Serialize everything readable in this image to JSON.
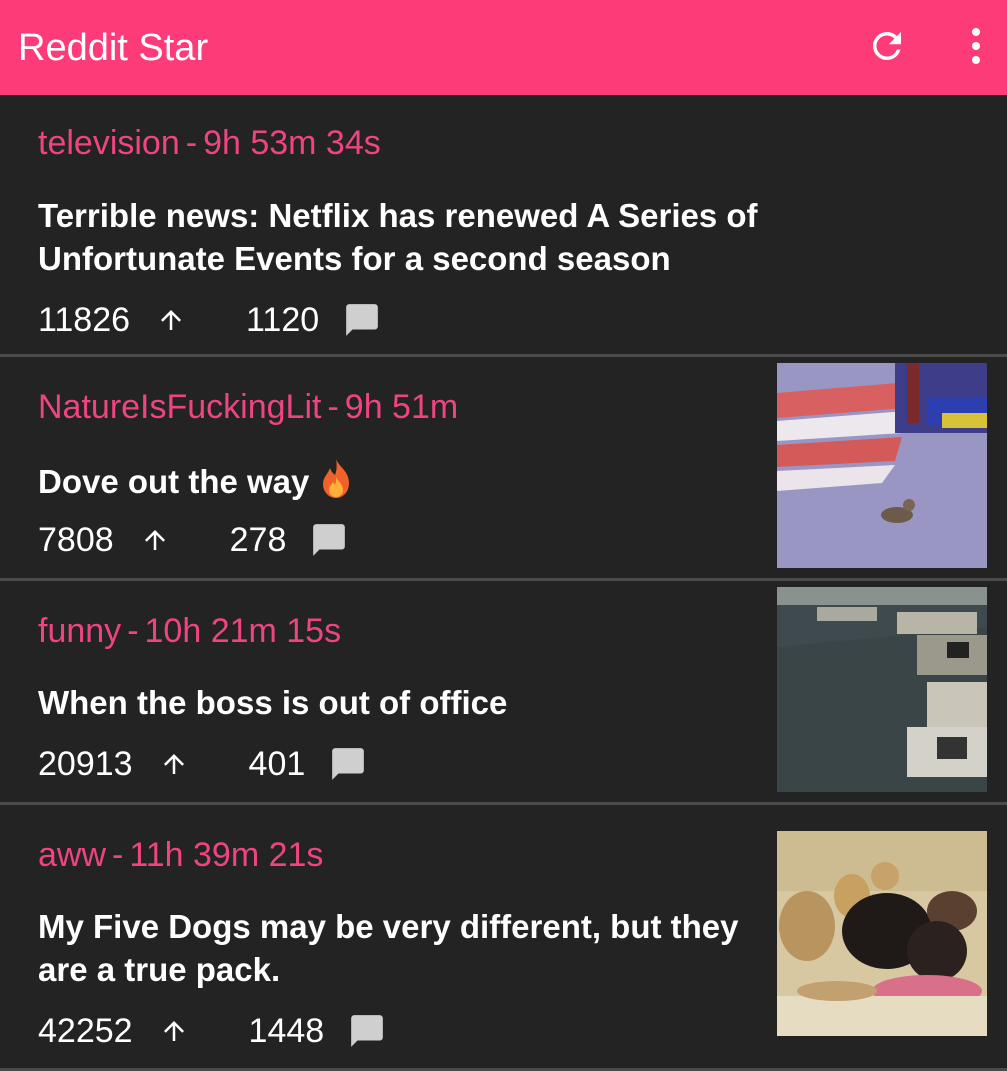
{
  "app": {
    "title": "Reddit Star",
    "bar_color": "#fd3b78",
    "actions": [
      {
        "name": "refresh-icon"
      },
      {
        "name": "more-vert-icon"
      }
    ]
  },
  "posts": [
    {
      "subreddit": "television",
      "age": "9h 53m 34s",
      "title": "Terrible news: Netflix has renewed A Series of Unfortunate Events for a second season",
      "upvotes": "11826",
      "comments": "1120",
      "thumbnail": null
    },
    {
      "subreddit": "NatureIsFuckingLit",
      "age": "9h 51m",
      "title": "Dove out the way",
      "title_emoji": "fire-icon",
      "upvotes": "7808",
      "comments": "278",
      "thumbnail": "dove-on-flag-thumbnail"
    },
    {
      "subreddit": "funny",
      "age": "10h 21m 15s",
      "title": "When the boss is out of office",
      "upvotes": "20913",
      "comments": "401",
      "thumbnail": "office-thumbnail"
    },
    {
      "subreddit": "aww",
      "age": "11h 39m 21s",
      "title": "My Five Dogs may be very different, but they are a true pack.",
      "upvotes": "42252",
      "comments": "1448",
      "thumbnail": "dogs-on-couch-thumbnail"
    }
  ],
  "colors": {
    "background": "#232323",
    "subreddit_text": "#ee4482",
    "divider": "#4a4a4a"
  }
}
